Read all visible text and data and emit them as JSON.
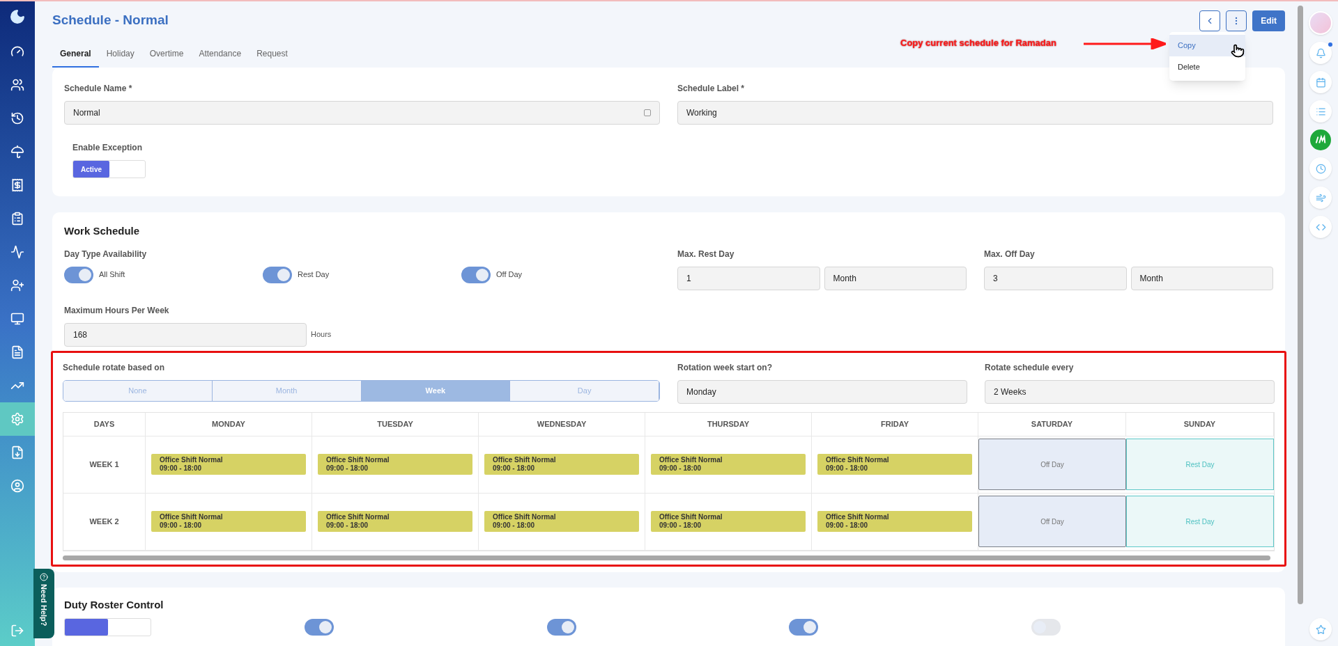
{
  "sidebar": {
    "items": [
      {
        "selected": false
      },
      {
        "selected": false
      },
      {
        "selected": false
      },
      {
        "selected": false
      },
      {
        "selected": false
      },
      {
        "selected": false
      },
      {
        "selected": false
      },
      {
        "selected": false
      },
      {
        "selected": false
      },
      {
        "selected": false
      },
      {
        "selected": false
      },
      {
        "selected": true
      },
      {
        "selected": false
      },
      {
        "selected": false
      }
    ]
  },
  "header": {
    "title": "Schedule - Normal",
    "edit_button": "Edit"
  },
  "menu": {
    "items": [
      {
        "label": "Copy",
        "selected": true
      },
      {
        "label": "Delete",
        "selected": false
      }
    ]
  },
  "annotation": {
    "text": "Copy current schedule for Ramadan"
  },
  "tabs": [
    {
      "label": "General",
      "selected": true
    },
    {
      "label": "Holiday",
      "selected": false
    },
    {
      "label": "Overtime",
      "selected": false
    },
    {
      "label": "Attendance",
      "selected": false
    },
    {
      "label": "Request",
      "selected": false
    }
  ],
  "general": {
    "schedule_name": {
      "label": "Schedule Name *",
      "value": "Normal"
    },
    "schedule_label": {
      "label": "Schedule Label *",
      "value": "Working"
    },
    "enable_exception": {
      "label": "Enable Exception",
      "state_label": "Active",
      "on": true
    }
  },
  "work_schedule": {
    "title": "Work Schedule",
    "day_type_label": "Day Type Availability",
    "day_types": [
      {
        "label": "All Shift",
        "on": true
      },
      {
        "label": "Rest Day",
        "on": true
      },
      {
        "label": "Off Day",
        "on": true
      }
    ],
    "max_rest_day": {
      "label": "Max. Rest Day",
      "value": "1",
      "unit": "Month"
    },
    "max_off_day": {
      "label": "Max. Off Day",
      "value": "3",
      "unit": "Month"
    },
    "max_hours": {
      "label": "Maximum Hours Per Week",
      "value": "168",
      "unit": "Hours"
    },
    "rotate_label": "Schedule rotate based on",
    "rotate_options": [
      {
        "label": "None",
        "selected": false
      },
      {
        "label": "Month",
        "selected": false
      },
      {
        "label": "Week",
        "selected": true
      },
      {
        "label": "Day",
        "selected": false
      }
    ],
    "rotation_start": {
      "label": "Rotation week start on?",
      "value": "Monday"
    },
    "rotate_every": {
      "label": "Rotate schedule every",
      "value": "2 Weeks"
    },
    "table": {
      "columns": [
        "DAYS",
        "MONDAY",
        "TUESDAY",
        "WEDNESDAY",
        "THURSDAY",
        "FRIDAY",
        "SATURDAY",
        "SUNDAY"
      ],
      "rows": [
        {
          "cells": [
            {
              "kind": "label",
              "name": "WEEK 1"
            },
            {
              "kind": "shift",
              "name": "Office Shift Normal",
              "time": "09:00 - 18:00"
            },
            {
              "kind": "shift",
              "name": "Office Shift Normal",
              "time": "09:00 - 18:00"
            },
            {
              "kind": "shift",
              "name": "Office Shift Normal",
              "time": "09:00 - 18:00"
            },
            {
              "kind": "shift",
              "name": "Office Shift Normal",
              "time": "09:00 - 18:00"
            },
            {
              "kind": "shift",
              "name": "Office Shift Normal",
              "time": "09:00 - 18:00"
            },
            {
              "kind": "off",
              "name": "Off Day"
            },
            {
              "kind": "rest",
              "name": "Rest Day"
            }
          ]
        },
        {
          "cells": [
            {
              "kind": "label",
              "name": "WEEK 2"
            },
            {
              "kind": "shift",
              "name": "Office Shift Normal",
              "time": "09:00 - 18:00"
            },
            {
              "kind": "shift",
              "name": "Office Shift Normal",
              "time": "09:00 - 18:00"
            },
            {
              "kind": "shift",
              "name": "Office Shift Normal",
              "time": "09:00 - 18:00"
            },
            {
              "kind": "shift",
              "name": "Office Shift Normal",
              "time": "09:00 - 18:00"
            },
            {
              "kind": "shift",
              "name": "Office Shift Normal",
              "time": "09:00 - 18:00"
            },
            {
              "kind": "off",
              "name": "Off Day"
            },
            {
              "kind": "rest",
              "name": "Rest Day"
            }
          ]
        }
      ]
    }
  },
  "duty_roster": {
    "title": "Duty Roster Control",
    "exception_on": true,
    "toggles": [
      {
        "on": true
      },
      {
        "on": true
      },
      {
        "on": true
      },
      {
        "on": false
      }
    ]
  },
  "help_tab": "Need Help?"
}
